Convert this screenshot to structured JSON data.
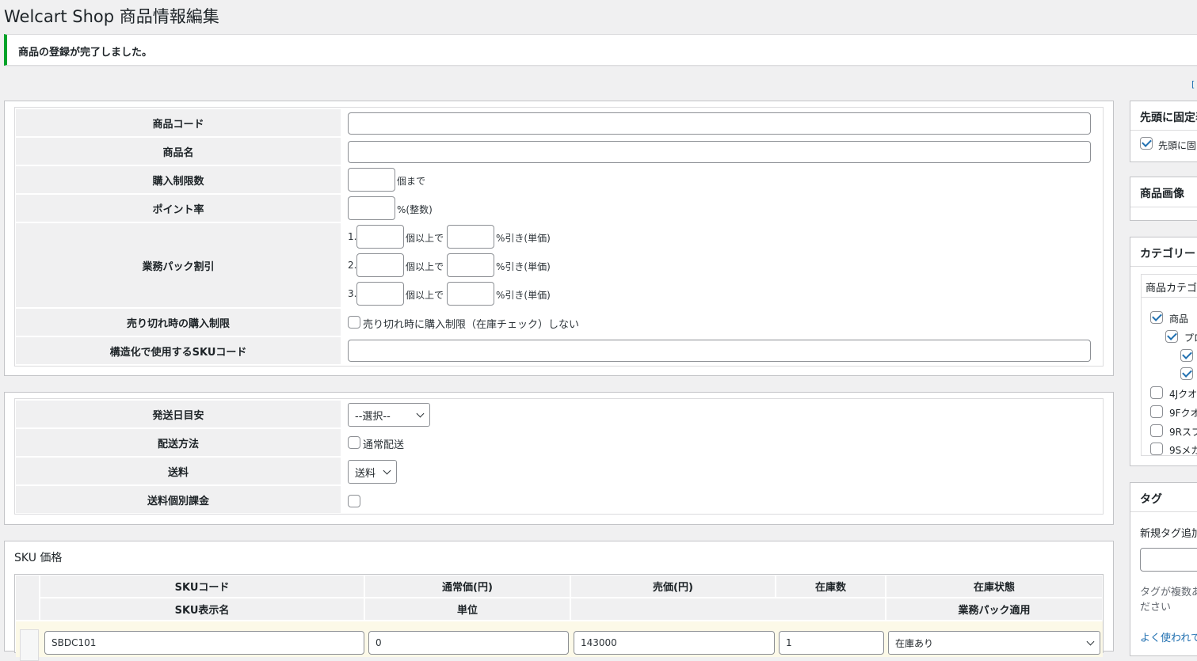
{
  "page_title": "Welcart Shop 商品情報編集",
  "notice": "商品の登録が完了しました。",
  "screen_options": "[",
  "basic": {
    "item_code_label": "商品コード",
    "item_code_value": "",
    "item_name_label": "商品名",
    "item_name_value": "",
    "limit_label": "購入制限数",
    "limit_value": "",
    "limit_suffix": "個まで",
    "point_label": "ポイント率",
    "point_value": "",
    "point_suffix": "%(整数)",
    "gp_label": "業務パック割引",
    "gp_rows": [
      {
        "num": "1.",
        "qty": "",
        "qty_suffix": "個以上で",
        "rate": "",
        "rate_suffix": "%引き(単価)"
      },
      {
        "num": "2.",
        "qty": "",
        "qty_suffix": "個以上で",
        "rate": "",
        "rate_suffix": "%引き(単価)"
      },
      {
        "num": "3.",
        "qty": "",
        "qty_suffix": "個以上で",
        "rate": "",
        "rate_suffix": "%引き(単価)"
      }
    ],
    "soldout_label": "売り切れ時の購入制限",
    "soldout_checkbox": "売り切れ時に購入制限（在庫チェック）しない",
    "sku_structured_label": "構造化で使用するSKUコード",
    "sku_structured_value": ""
  },
  "shipping": {
    "ship_date_label": "発送日目安",
    "ship_date_value": "--選択--",
    "method_label": "配送方法",
    "method_checkbox": "通常配送",
    "fee_label": "送料",
    "fee_value": "送料",
    "individual_label": "送料個別課金"
  },
  "sku": {
    "title": "SKU 価格",
    "headers_top": [
      "SKUコード",
      "通常価(円)",
      "売価(円)",
      "在庫数",
      "在庫状態"
    ],
    "headers_bottom": [
      "SKU表示名",
      "単位",
      "",
      "",
      "業務パック適用"
    ],
    "row": {
      "code": "SBDC101",
      "normal_price": "0",
      "price": "143000",
      "stock": "1",
      "status": "在庫あり"
    }
  },
  "sidebar": {
    "sticky_title": "先頭に固定表",
    "sticky_checkbox": "先頭に固",
    "image_title": "商品画像",
    "category_title": "カテゴリー",
    "category_tab": "商品カテゴ",
    "categories": [
      {
        "label": "商品",
        "checked": true,
        "indent": 0
      },
      {
        "label": "プロ",
        "checked": true,
        "indent": 1
      },
      {
        "label": "",
        "checked": true,
        "indent": 2
      },
      {
        "label": "",
        "checked": true,
        "indent": 2
      },
      {
        "label": "4Jクオ",
        "checked": false,
        "indent": 0
      },
      {
        "label": "9Fクオ",
        "checked": false,
        "indent": 0
      },
      {
        "label": "9Rスプ",
        "checked": false,
        "indent": 0
      },
      {
        "label": "9Sメカ",
        "checked": false,
        "indent": 0
      }
    ],
    "tag_title": "タグ",
    "tag_new_label": "新規タグ追加",
    "tag_hint_1": "タグが複数あ",
    "tag_hint_2": "ださい",
    "tag_popular_link": "よく使われて"
  },
  "colors": {
    "accent": "#2271b1",
    "success": "#00a32a",
    "label_bg": "#f0f0f1",
    "sku_row_bg": "#fcf9e8"
  }
}
